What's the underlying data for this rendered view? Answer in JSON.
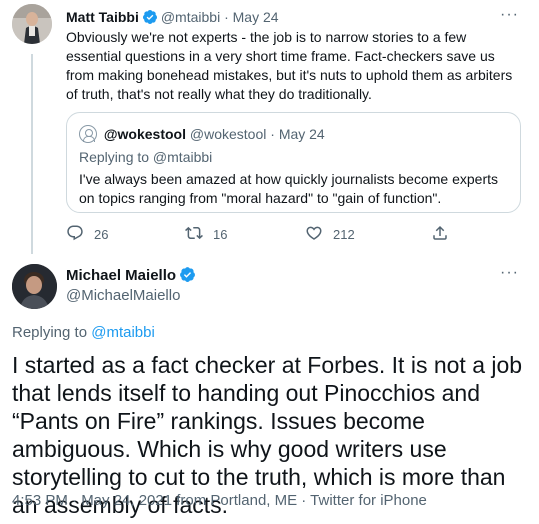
{
  "parent_tweet": {
    "author_name": "Matt Taibbi",
    "handle": "@mtaibbi",
    "separator": "·",
    "date": "May 24",
    "more_label": "···",
    "text": "Obviously we're not experts - the job is to narrow stories to a few essential questions in a very short time frame. Fact-checkers save us from making bonehead mistakes, but it's nuts to uphold them as arbiters of truth, that's not really what they do traditionally.",
    "quote": {
      "author_name": "@wokestool",
      "handle": "@wokestool",
      "separator": "·",
      "date": "May 24",
      "replying_to": "Replying to @mtaibbi",
      "text": "I've always been amazed at how quickly journalists become experts on topics ranging from \"moral hazard\" to \"gain of function\"."
    },
    "actions": {
      "reply_count": "26",
      "retweet_count": "16",
      "like_count": "212"
    }
  },
  "main_tweet": {
    "author_name": "Michael Maiello",
    "handle": "@MichaelMaiello",
    "more_label": "···",
    "replying_prefix": "Replying to ",
    "replying_handle": "@mtaibbi",
    "text": "I started as a fact checker at Forbes. It is not a job that lends itself to handing out Pinocchios and “Pants on Fire” rankings. Issues become ambiguous. Which is why good writers use storytelling to cut to the truth, which is more than an assembly of facts.",
    "meta": "4:53 PM · May 24, 2021 from Portland, ME · Twitter for iPhone"
  },
  "colors": {
    "accent": "#1d9bf0",
    "muted": "#536471",
    "border": "#cfd9de"
  },
  "icons": [
    "verified-badge-icon",
    "reply-icon",
    "retweet-icon",
    "like-icon",
    "share-icon",
    "more-icon",
    "default-avatar-icon"
  ]
}
